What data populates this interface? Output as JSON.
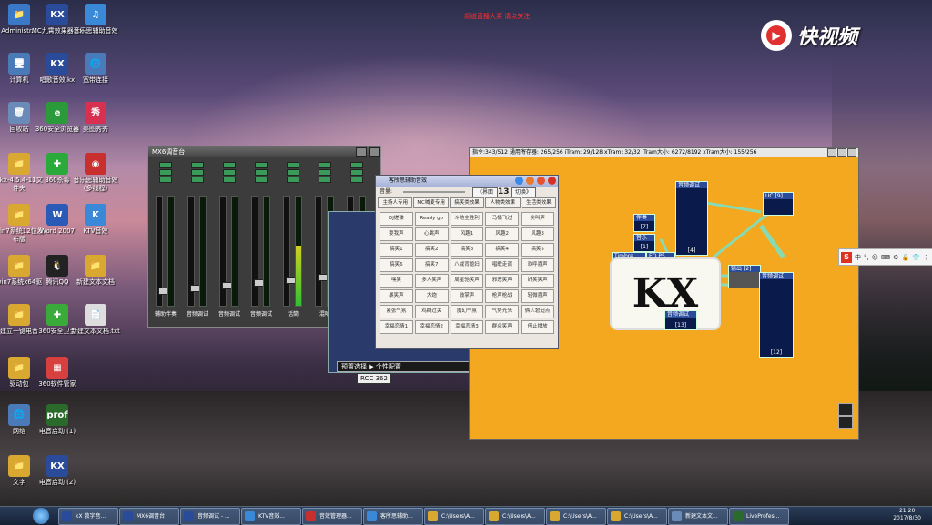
{
  "top_notice": "频道直播大奖 请点关注",
  "watermark": {
    "text": "快视频"
  },
  "desktop_icons": [
    {
      "label": "Administr...",
      "color": "#3a78c8",
      "glyph": "📁"
    },
    {
      "label": "MC九霄效果器.kx",
      "color": "#2a4a9a",
      "glyph": "KX"
    },
    {
      "label": "音乐思辅助音效",
      "color": "#3a88d8",
      "glyph": "♫"
    },
    {
      "label": "计算机",
      "color": "#4a7ab8",
      "glyph": "🖥"
    },
    {
      "label": "唱歌音效.kx",
      "color": "#2a4a9a",
      "glyph": "KX"
    },
    {
      "label": "宽带连接",
      "color": "#4a7ab8",
      "glyph": "🌐"
    },
    {
      "label": "回收站",
      "color": "#6a8ab8",
      "glyph": "🗑"
    },
    {
      "label": "360安全浏览器",
      "color": "#2a9a3a",
      "glyph": "e"
    },
    {
      "label": "美图秀秀",
      "color": "#d83050",
      "glyph": "秀"
    },
    {
      "label": "7kx-4.5.4-11文件夹",
      "color": "#d8a830",
      "glyph": "📁"
    },
    {
      "label": "360杀毒",
      "color": "#2aaa3a",
      "glyph": "✚"
    },
    {
      "label": "音乐思辅助音效(多线程)",
      "color": "#c83030",
      "glyph": "◉"
    },
    {
      "label": "win7系统12位发布版",
      "color": "#d8a830",
      "glyph": "📁"
    },
    {
      "label": "Word 2007",
      "color": "#2a5ab8",
      "glyph": "W"
    },
    {
      "label": "KTV音效",
      "color": "#3a88d8",
      "glyph": "K"
    },
    {
      "label": "win7系统x64驱",
      "color": "#d8a830",
      "glyph": "📁"
    },
    {
      "label": "腾讯QQ",
      "color": "#222",
      "glyph": "🐧"
    },
    {
      "label": "新建文本文档",
      "color": "#d8a830",
      "glyph": "📁"
    },
    {
      "label": "建立一键电音",
      "color": "#d8a830",
      "glyph": "📁"
    },
    {
      "label": "360安全卫士",
      "color": "#3aaa3a",
      "glyph": "✚"
    },
    {
      "label": "新建文本文档.txt",
      "color": "#ddd",
      "glyph": "📄"
    },
    {
      "label": "驱动包",
      "color": "#d8a830",
      "glyph": "📁"
    },
    {
      "label": "360软件管家",
      "color": "#d84040",
      "glyph": "▦"
    },
    {
      "label": "网络",
      "color": "#4a7ab8",
      "glyph": "🌐"
    },
    {
      "label": "电音启动 (1)",
      "color": "#2a6a2a",
      "glyph": "prof"
    },
    {
      "label": "文字",
      "color": "#d8a830",
      "glyph": "📁"
    },
    {
      "label": "电音启动 (2)",
      "color": "#2a4a9a",
      "glyph": "KX"
    }
  ],
  "mixer": {
    "title": "MX6调音台",
    "strips": [
      {
        "name": "辅助伴奏",
        "level": 0.0
      },
      {
        "name": "音频调试",
        "level": 0.0
      },
      {
        "name": "音频调试",
        "level": 0.0
      },
      {
        "name": "音频调试",
        "level": 0.0
      },
      {
        "name": "话筒",
        "level": 0.55
      },
      {
        "name": "混响",
        "level": 0.6
      },
      {
        "name": "远声音量",
        "level": 0.0
      }
    ]
  },
  "panel": {
    "display": "888",
    "preset_label": "预置选择 ▶ 个性配置",
    "plate": "RCC 362"
  },
  "sfx": {
    "title": "客所思辅助音效",
    "volume_label": "音量:",
    "btn_left": "《界面",
    "number": "13",
    "btn_right": "切换》",
    "tabs": [
      "主持人专用",
      "MC喊麦专用",
      "搞笑类效果",
      "人物类效果",
      "生活类效果"
    ],
    "cells": [
      "DJ搓碟",
      "Ready go",
      "斗地主胜利",
      "马桶飞过",
      "尖叫声",
      "耍我声",
      "心跳声",
      "风趣1",
      "风趣2",
      "风趣3",
      "搞笑1",
      "搞笑2",
      "搞笑3",
      "搞笑4",
      "搞笑5",
      "搞笑6",
      "搞笑7",
      "八戒背媳妇",
      "唱歌走调",
      "欢呼喜声",
      "嘿笑",
      "多人笑声",
      "周星驰笑声",
      "邪恶笑声",
      "奸笑笑声",
      "暴笑声",
      "大炮",
      "鼓掌声",
      "枪声枪战",
      "轻微喜声",
      "紧张气氛",
      "鸡群过关",
      "魔幻气氛",
      "气势光头",
      "俩人窘迫点",
      "幸福恋情1",
      "幸福恋情2",
      "幸福恋情3",
      "群众笑声",
      "停止播放"
    ]
  },
  "kx": {
    "title": "指令:343/512 通用寄存器: 265/256 iTram: 29/128 xTram: 32/32 iTram大小: 6272/8192 xTram大小: 155/256",
    "blocks": [
      {
        "name": "音频调试",
        "num": "[4]"
      },
      {
        "name": "UC [9]",
        "num": ""
      },
      {
        "name": "伴奏",
        "num": "[7]"
      },
      {
        "name": "",
        "num": "[1]"
      },
      {
        "name": "Timbre",
        "num": ""
      },
      {
        "name": "EQ P5",
        "num": ""
      },
      {
        "name": "输出 [2]",
        "num": ""
      },
      {
        "name": "音频调试",
        "num": "[12]"
      },
      {
        "name": "音频调试",
        "num": "[13]"
      },
      {
        "name": "音乐",
        "num": ""
      }
    ],
    "logo": "KX"
  },
  "ime": {
    "items": [
      "中",
      "°,",
      "☺",
      "⌨",
      "⚙",
      "🔒",
      "👕",
      "⋮"
    ]
  },
  "taskbar": {
    "items": [
      {
        "label": "kX 数字音...",
        "color": "#2a4a9a"
      },
      {
        "label": "MX6调音台",
        "color": "#2a4a9a"
      },
      {
        "label": "音频调试 - ...",
        "color": "#2a4a9a"
      },
      {
        "label": "KTV音效...",
        "color": "#3a88d8"
      },
      {
        "label": "音效管理器...",
        "color": "#c83030"
      },
      {
        "label": "客所思辅助...",
        "color": "#3a88d8"
      },
      {
        "label": "C:\\Users\\A...",
        "color": "#d8a830"
      },
      {
        "label": "C:\\Users\\A...",
        "color": "#d8a830"
      },
      {
        "label": "C:\\Users\\A...",
        "color": "#d8a830"
      },
      {
        "label": "C:\\Users\\A...",
        "color": "#d8a830"
      },
      {
        "label": "新建文本文...",
        "color": "#6a8ab8"
      },
      {
        "label": "LiveProfes...",
        "color": "#2a6a2a"
      }
    ],
    "time": "21:20",
    "date": "2017/8/30"
  }
}
